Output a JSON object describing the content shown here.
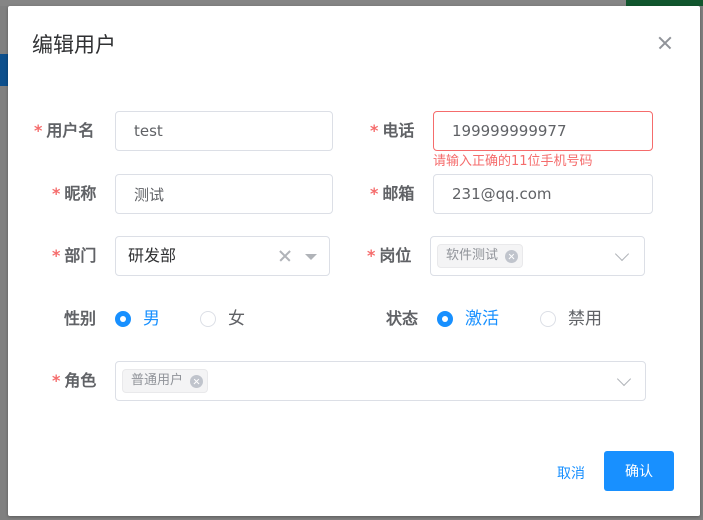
{
  "dialog": {
    "title": "编辑用户",
    "form": {
      "username": {
        "label": "用户名",
        "value": "test",
        "required": true
      },
      "phone": {
        "label": "电话",
        "value": "199999999977",
        "required": true,
        "error": "请输入正确的11位手机号码"
      },
      "nickname": {
        "label": "昵称",
        "value": "测试",
        "required": true
      },
      "email": {
        "label": "邮箱",
        "value": "231@qq.com",
        "required": true
      },
      "department": {
        "label": "部门",
        "value": "研发部",
        "required": true
      },
      "position": {
        "label": "岗位",
        "tags": [
          "软件测试"
        ],
        "required": true
      },
      "gender": {
        "label": "性别",
        "options": [
          "男",
          "女"
        ],
        "selected": "男"
      },
      "status": {
        "label": "状态",
        "options": [
          "激活",
          "禁用"
        ],
        "selected": "激活"
      },
      "role": {
        "label": "角色",
        "tags": [
          "普通用户"
        ],
        "required": true
      }
    },
    "buttons": {
      "cancel": "取消",
      "confirm": "确认"
    }
  },
  "colors": {
    "primary": "#1890ff",
    "error": "#f56c6c",
    "required_mark": "#f56c6c",
    "text": "#606266",
    "border": "#dcdfe6"
  },
  "icons": [
    "close-icon",
    "clear-icon",
    "caret-down-icon",
    "chevron-down-icon",
    "tag-close-icon"
  ]
}
